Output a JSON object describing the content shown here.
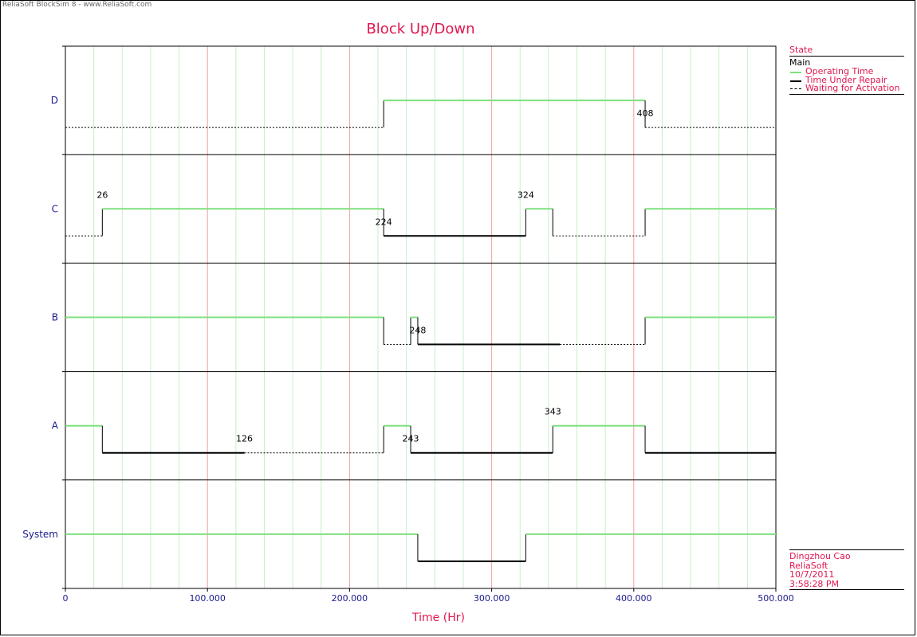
{
  "window": {
    "watermark": "ReliaSoft BlockSim 8 - www.ReliaSoft.com"
  },
  "colors": {
    "operating": "#7ee07e",
    "repair": "#000000",
    "waiting": "#000000",
    "grid_major": "#f2a0a0",
    "grid_minor": "#c8eec8",
    "accent": "#e0184f",
    "axis_text": "#1a1a8c"
  },
  "legend": {
    "title": "State",
    "group": "Main",
    "items": [
      {
        "label": "Operating Time",
        "style": "operating"
      },
      {
        "label": "Time Under Repair",
        "style": "repair"
      },
      {
        "label": "Waiting for Activation",
        "style": "waiting"
      }
    ]
  },
  "footer": {
    "author": "Dingzhou Cao",
    "company": "ReliaSoft",
    "date": "10/7/2011",
    "time": "3:58:28 PM"
  },
  "chart_data": {
    "type": "line",
    "title": "Block Up/Down",
    "xlabel": "Time (Hr)",
    "xlim": [
      0,
      500
    ],
    "xticks": [
      0,
      100,
      200,
      300,
      400,
      500
    ],
    "xtick_labels": [
      "0",
      "100.000",
      "200.000",
      "300.000",
      "400.000",
      "500.000"
    ],
    "grid": true,
    "legend_position": "top-right",
    "blocks": [
      {
        "name": "D",
        "labels": [
          {
            "t": 408,
            "text": "408"
          }
        ],
        "segments": [
          {
            "state": "waiting",
            "start": 0,
            "end": 224
          },
          {
            "state": "operating",
            "start": 224,
            "end": 408
          },
          {
            "state": "waiting",
            "start": 408,
            "end": 500
          }
        ]
      },
      {
        "name": "C",
        "labels": [
          {
            "t": 26,
            "text": "26"
          },
          {
            "t": 224,
            "text": "224"
          },
          {
            "t": 324,
            "text": "324"
          }
        ],
        "segments": [
          {
            "state": "waiting",
            "start": 0,
            "end": 26
          },
          {
            "state": "operating",
            "start": 26,
            "end": 224
          },
          {
            "state": "repair",
            "start": 224,
            "end": 324
          },
          {
            "state": "operating",
            "start": 324,
            "end": 343
          },
          {
            "state": "waiting",
            "start": 343,
            "end": 408
          },
          {
            "state": "operating",
            "start": 408,
            "end": 500
          }
        ]
      },
      {
        "name": "B",
        "labels": [
          {
            "t": 248,
            "text": "248"
          }
        ],
        "segments": [
          {
            "state": "operating",
            "start": 0,
            "end": 224
          },
          {
            "state": "waiting",
            "start": 224,
            "end": 243
          },
          {
            "state": "operating",
            "start": 243,
            "end": 248
          },
          {
            "state": "repair",
            "start": 248,
            "end": 348
          },
          {
            "state": "waiting",
            "start": 348,
            "end": 408
          },
          {
            "state": "operating",
            "start": 408,
            "end": 500
          }
        ]
      },
      {
        "name": "A",
        "labels": [
          {
            "t": 126,
            "text": "126"
          },
          {
            "t": 243,
            "text": "243"
          },
          {
            "t": 343,
            "text": "343"
          }
        ],
        "segments": [
          {
            "state": "operating",
            "start": 0,
            "end": 26
          },
          {
            "state": "repair",
            "start": 26,
            "end": 126
          },
          {
            "state": "waiting",
            "start": 126,
            "end": 224
          },
          {
            "state": "operating",
            "start": 224,
            "end": 243
          },
          {
            "state": "repair",
            "start": 243,
            "end": 343
          },
          {
            "state": "operating",
            "start": 343,
            "end": 408
          },
          {
            "state": "repair",
            "start": 408,
            "end": 500
          }
        ]
      },
      {
        "name": "System",
        "labels": [],
        "segments": [
          {
            "state": "operating",
            "start": 0,
            "end": 248
          },
          {
            "state": "repair",
            "start": 248,
            "end": 324
          },
          {
            "state": "operating",
            "start": 324,
            "end": 500
          }
        ]
      }
    ]
  }
}
